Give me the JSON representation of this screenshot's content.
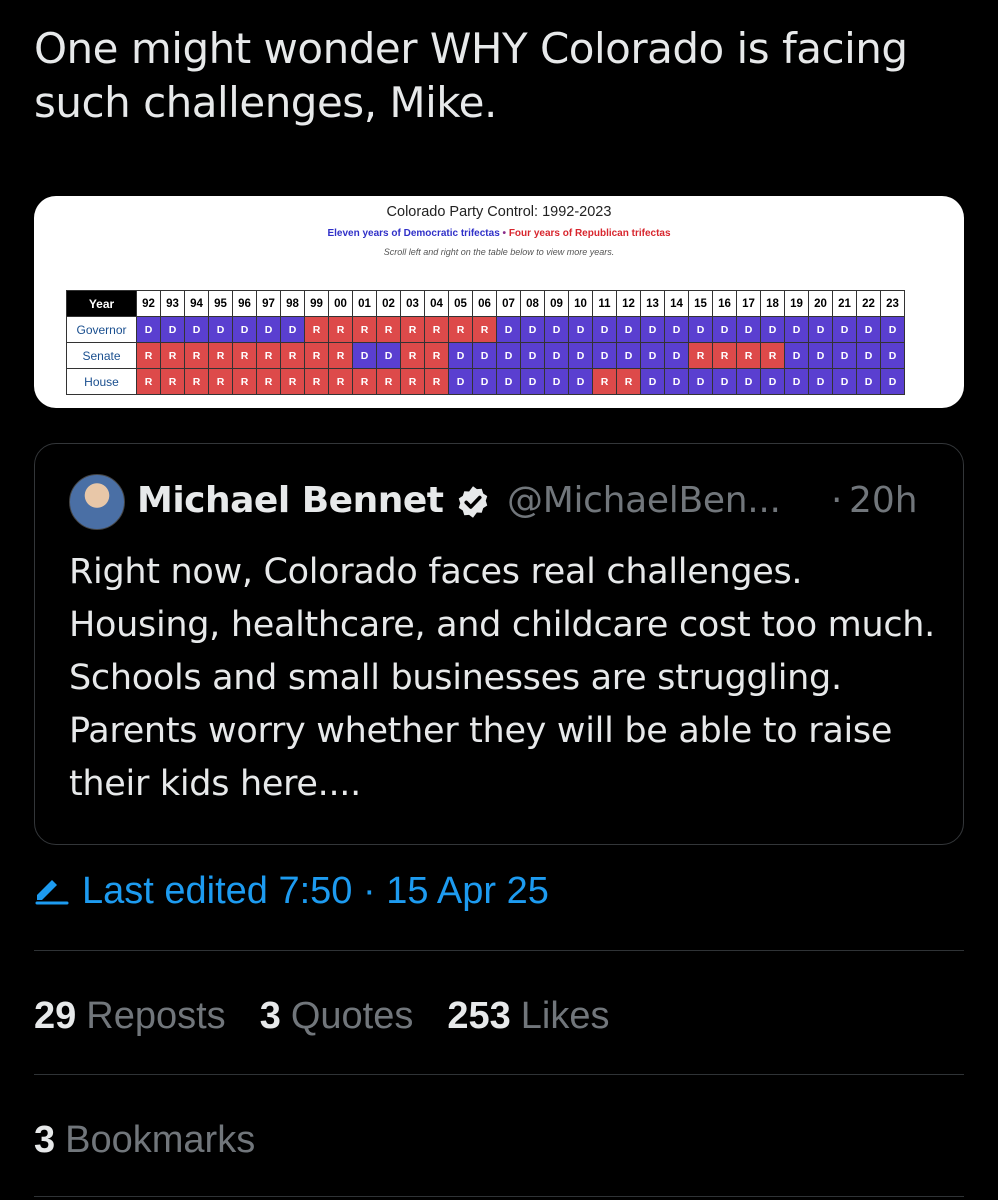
{
  "tweet": {
    "text": "One might wonder WHY Colorado is facing such challenges, Mike."
  },
  "media": {
    "title": "Colorado Party Control: 1992-2023",
    "subtitle_dem": "Eleven years of Democratic trifectas",
    "subtitle_sep": " • ",
    "subtitle_rep": "Four years of Republican trifectas",
    "note": "Scroll left and right on the table below to view more years.",
    "table": {
      "year_header": "Year",
      "years": [
        "92",
        "93",
        "94",
        "95",
        "96",
        "97",
        "98",
        "99",
        "00",
        "01",
        "02",
        "03",
        "04",
        "05",
        "06",
        "07",
        "08",
        "09",
        "10",
        "11",
        "12",
        "13",
        "14",
        "15",
        "16",
        "17",
        "18",
        "19",
        "20",
        "21",
        "22",
        "23"
      ],
      "rows": [
        {
          "label": "Governor",
          "values": [
            "D",
            "D",
            "D",
            "D",
            "D",
            "D",
            "D",
            "R",
            "R",
            "R",
            "R",
            "R",
            "R",
            "R",
            "R",
            "D",
            "D",
            "D",
            "D",
            "D",
            "D",
            "D",
            "D",
            "D",
            "D",
            "D",
            "D",
            "D",
            "D",
            "D",
            "D",
            "D"
          ]
        },
        {
          "label": "Senate",
          "values": [
            "R",
            "R",
            "R",
            "R",
            "R",
            "R",
            "R",
            "R",
            "R",
            "D",
            "D",
            "R",
            "R",
            "D",
            "D",
            "D",
            "D",
            "D",
            "D",
            "D",
            "D",
            "D",
            "D",
            "R",
            "R",
            "R",
            "R",
            "D",
            "D",
            "D",
            "D",
            "D"
          ]
        },
        {
          "label": "House",
          "values": [
            "R",
            "R",
            "R",
            "R",
            "R",
            "R",
            "R",
            "R",
            "R",
            "R",
            "R",
            "R",
            "R",
            "D",
            "D",
            "D",
            "D",
            "D",
            "D",
            "R",
            "R",
            "D",
            "D",
            "D",
            "D",
            "D",
            "D",
            "D",
            "D",
            "D",
            "D",
            "D"
          ]
        }
      ],
      "colors": {
        "D": "#5a3fd0",
        "R": "#dd4a4a"
      }
    }
  },
  "quote": {
    "author_name": "Michael Bennet",
    "handle": "@MichaelBen...",
    "separator": "·",
    "timestamp": "20h",
    "verified_icon": "verified-badge-icon",
    "text": "Right now, Colorado faces real challenges. Housing, healthcare, and childcare cost too much. Schools and small businesses are struggling. Parents worry whether they will be able to raise their kids here...."
  },
  "edit": {
    "icon": "pencil-icon",
    "label": "Last edited 7:50 · 15 Apr 25"
  },
  "stats": {
    "reposts_count": "29",
    "reposts_label": "Reposts",
    "quotes_count": "3",
    "quotes_label": "Quotes",
    "likes_count": "253",
    "likes_label": "Likes",
    "bookmarks_count": "3",
    "bookmarks_label": "Bookmarks"
  },
  "colors": {
    "background": "#000000",
    "text": "#e7e9ea",
    "muted": "#71767b",
    "accent": "#1d9bf0"
  }
}
